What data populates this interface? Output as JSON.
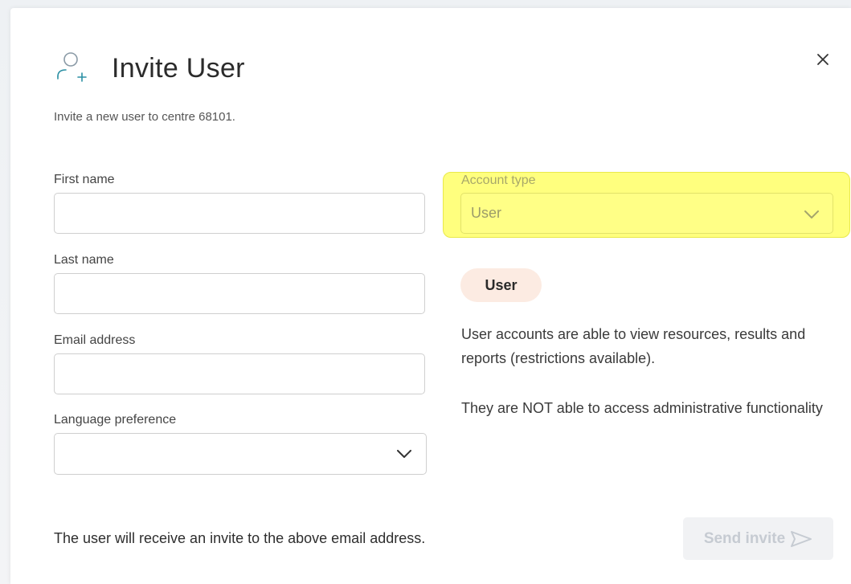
{
  "dialog": {
    "title": "Invite User",
    "subtitle": "Invite a new user to centre 68101.",
    "close_icon": "close-icon",
    "title_icon": "user-plus-icon"
  },
  "form": {
    "first_name": {
      "label": "First name",
      "value": ""
    },
    "last_name": {
      "label": "Last name",
      "value": ""
    },
    "email": {
      "label": "Email address",
      "value": ""
    },
    "language": {
      "label": "Language preference",
      "value": ""
    },
    "account_type": {
      "label": "Account type",
      "value": "User"
    }
  },
  "role_info": {
    "badge": "User",
    "description_1": "User accounts are able to view resources, results and reports (restrictions available).",
    "description_2": "They are NOT able to access administrative functionality"
  },
  "footer": {
    "note": "The user will receive an invite to the above email address.",
    "send_label": "Send invite",
    "send_icon": "send-arrow-icon"
  },
  "colors": {
    "accent_teal": "#2a8fa3",
    "highlight": "#ffff7e",
    "badge_bg": "#fcebe2",
    "disabled_text": "#c6cbd2"
  }
}
